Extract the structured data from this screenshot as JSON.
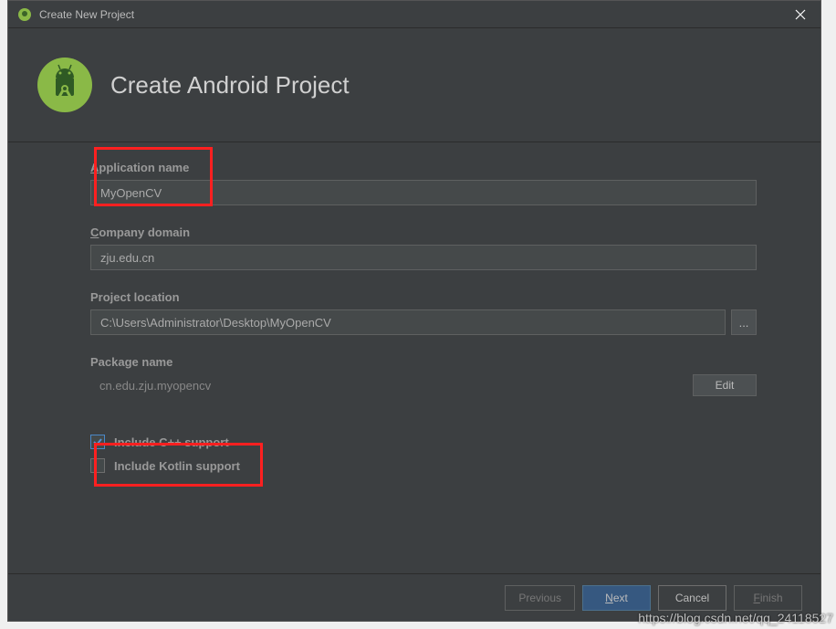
{
  "titlebar": {
    "title": "Create New Project"
  },
  "header": {
    "title": "Create Android Project"
  },
  "fields": {
    "appName": {
      "label_pre": "A",
      "label_rest": "pplication name",
      "value": "MyOpenCV"
    },
    "companyDomain": {
      "label_pre": "C",
      "label_rest": "ompany domain",
      "value": "zju.edu.cn"
    },
    "projectLocation": {
      "label": "Project location",
      "value": "C:\\Users\\Administrator\\Desktop\\MyOpenCV",
      "browse": "..."
    },
    "packageName": {
      "label": "Package name",
      "value": "cn.edu.zju.myopencv",
      "editBtn": "Edit"
    }
  },
  "checkboxes": {
    "cpp": {
      "label": "Include C++ support",
      "checked": true
    },
    "kotlin": {
      "label": "Include Kotlin support",
      "checked": false
    }
  },
  "footer": {
    "previous": "Previous",
    "next_pre": "N",
    "next_rest": "ext",
    "cancel": "Cancel",
    "finish_pre": "F",
    "finish_rest": "inish"
  },
  "watermark": "https://blog.csdn.net/qq_24118527"
}
